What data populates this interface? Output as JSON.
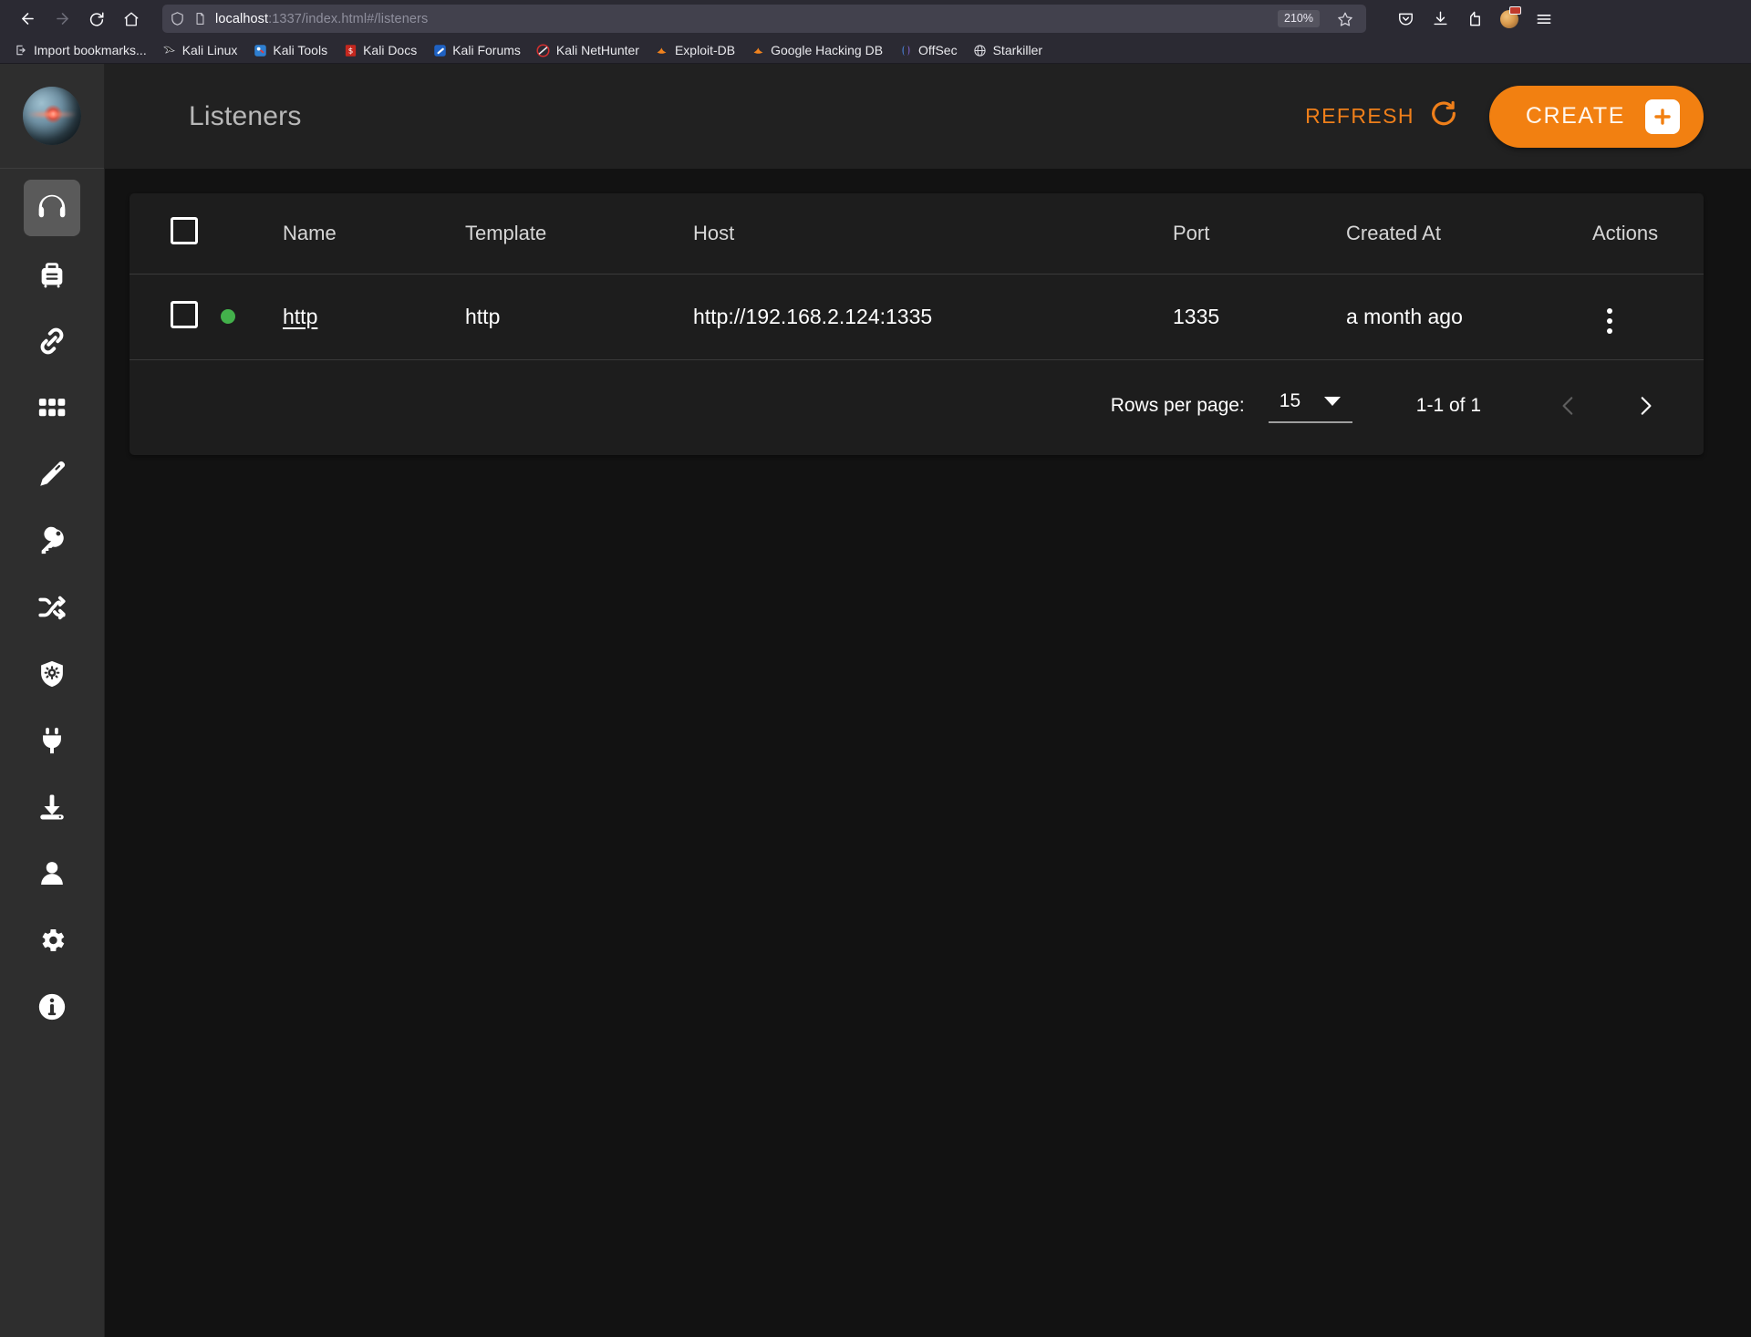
{
  "browser": {
    "url_host": "localhost",
    "url_rest": ":1337/index.html#/listeners",
    "zoom_level": "210%",
    "back_tooltip": "Back",
    "forward_tooltip": "Forward",
    "reload_tooltip": "Reload",
    "home_tooltip": "Home",
    "bookmarks": [
      {
        "label": "Import bookmarks...",
        "icon": "import-icon"
      },
      {
        "label": "Kali Linux",
        "icon": "kali-dragon-icon"
      },
      {
        "label": "Kali Tools",
        "icon": "kali-tools-icon"
      },
      {
        "label": "Kali Docs",
        "icon": "kali-docs-icon"
      },
      {
        "label": "Kali Forums",
        "icon": "kali-forums-icon"
      },
      {
        "label": "Kali NetHunter",
        "icon": "kali-nethunter-icon"
      },
      {
        "label": "Exploit-DB",
        "icon": "exploit-db-icon"
      },
      {
        "label": "Google Hacking DB",
        "icon": "google-hacking-db-icon"
      },
      {
        "label": "OffSec",
        "icon": "offsec-icon"
      },
      {
        "label": "Starkiller",
        "icon": "starkiller-globe-icon"
      }
    ]
  },
  "sidebar": {
    "logo_name": "starkiller-logo",
    "items": [
      {
        "name": "listeners",
        "icon": "headphones-icon",
        "active": true
      },
      {
        "name": "stagers",
        "icon": "briefcase-icon",
        "active": false
      },
      {
        "name": "agents",
        "icon": "link-chain-icon",
        "active": false
      },
      {
        "name": "modules",
        "icon": "grid-apps-icon",
        "active": false
      },
      {
        "name": "hooks",
        "icon": "marker-pen-icon",
        "active": false
      },
      {
        "name": "credentials",
        "icon": "key-icon",
        "active": false
      },
      {
        "name": "plugins-shuffle",
        "icon": "shuffle-icon",
        "active": false
      },
      {
        "name": "malware-shield",
        "icon": "shield-virus-icon",
        "active": false
      },
      {
        "name": "plugins",
        "icon": "power-plug-icon",
        "active": false
      },
      {
        "name": "downloads",
        "icon": "download-icon",
        "active": false
      },
      {
        "name": "users",
        "icon": "user-icon",
        "active": false
      },
      {
        "name": "settings",
        "icon": "gear-icon",
        "active": false
      },
      {
        "name": "about",
        "icon": "info-icon",
        "active": false
      }
    ]
  },
  "header": {
    "title": "Listeners",
    "refresh_label": "REFRESH",
    "refresh_icon": "refresh-icon",
    "create_label": "CREATE",
    "create_icon": "plus-icon"
  },
  "table": {
    "columns": [
      "",
      "",
      "Name",
      "Template",
      "Host",
      "Port",
      "Created At",
      "Actions"
    ],
    "header_labels": {
      "name": "Name",
      "template": "Template",
      "host": "Host",
      "port": "Port",
      "created_at": "Created At",
      "actions": "Actions"
    },
    "select_all_checked": false,
    "rows": [
      {
        "checked": false,
        "status": "active",
        "status_color": "#43b14b",
        "name": "http",
        "template": "http",
        "host": "http://192.168.2.124:1335",
        "port": "1335",
        "created_at": "a month ago",
        "actions_icon": "kebab-menu-icon"
      }
    ]
  },
  "pagination": {
    "rows_per_page_label": "Rows per page:",
    "rows_per_page_value": "15",
    "range_label": "1-1 of 1",
    "prev_icon": "chevron-left-icon",
    "next_icon": "chevron-right-icon",
    "prev_disabled": true,
    "next_disabled": false
  },
  "colors": {
    "accent": "#f28011",
    "status_ok": "#43b14b",
    "sidebar_bg": "#2e2e2e",
    "topbar_bg": "#212121",
    "page_bg": "#121212",
    "card_bg": "#1d1d1d"
  }
}
